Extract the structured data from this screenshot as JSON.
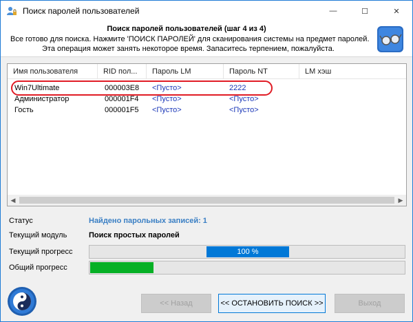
{
  "window": {
    "title": "Поиск паролей пользователей",
    "min_glyph": "—",
    "max_glyph": "☐",
    "close_glyph": "✕"
  },
  "header": {
    "title": "Поиск паролей пользователей (шаг 4 из 4)",
    "description_line1": "Все готово для поиска. Нажмите 'ПОИСК ПАРОЛЕЙ' для сканирования системы на предмет паролей.",
    "description_line2": "Эта операция может занять некоторое время. Запаситесь терпением, пожалуйста."
  },
  "table": {
    "columns": [
      "Имя пользователя",
      "RID пол...",
      "Пароль LM",
      "Пароль NT",
      "LM хэш"
    ],
    "rows": [
      {
        "user": "Win7Ultimate",
        "rid": "000003E8",
        "lm": "<Пусто>",
        "nt": "2222"
      },
      {
        "user": "Администратор",
        "rid": "000001F4",
        "lm": "<Пусто>",
        "nt": "<Пусто>"
      },
      {
        "user": "Гость",
        "rid": "000001F5",
        "lm": "<Пусто>",
        "nt": "<Пусто>"
      }
    ],
    "scroll_left_glyph": "◀",
    "scroll_right_glyph": "▶"
  },
  "status": {
    "status_label": "Статус",
    "status_value": "Найдено парольных записей: 1",
    "module_label": "Текущий модуль",
    "module_value": "Поиск простых паролей",
    "current_progress_label": "Текущий прогресс",
    "current_progress_text": "100 %",
    "current_progress_fraction": 1.0,
    "total_progress_label": "Общий прогресс",
    "total_progress_fraction": 0.2
  },
  "buttons": {
    "back": "<< Назад",
    "stop": "<< ОСТАНОВИТЬ ПОИСК >>",
    "exit": "Выход"
  },
  "colors": {
    "accent_blue": "#0078d7",
    "progress_green": "#06b025",
    "status_blue": "#3a7fc4",
    "highlight_red": "#e01b24",
    "link_blue": "#1a37b8"
  },
  "icons": {
    "title": "user-lock-icon",
    "header": "glasses-icon",
    "bottom": "yin-yang-icon"
  }
}
